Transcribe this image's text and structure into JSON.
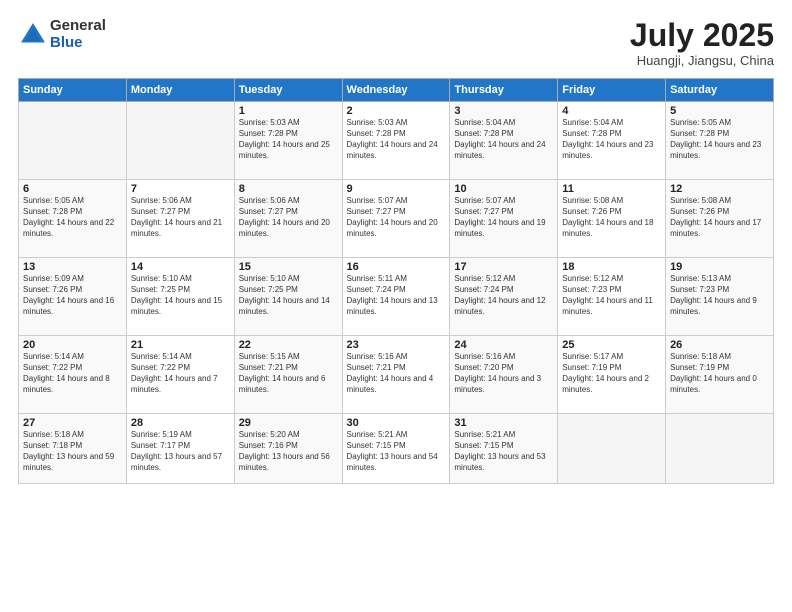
{
  "header": {
    "logo_general": "General",
    "logo_blue": "Blue",
    "month_title": "July 2025",
    "location": "Huangji, Jiangsu, China"
  },
  "weekdays": [
    "Sunday",
    "Monday",
    "Tuesday",
    "Wednesday",
    "Thursday",
    "Friday",
    "Saturday"
  ],
  "weeks": [
    [
      {
        "day": "",
        "sunrise": "",
        "sunset": "",
        "daylight": ""
      },
      {
        "day": "",
        "sunrise": "",
        "sunset": "",
        "daylight": ""
      },
      {
        "day": "1",
        "sunrise": "Sunrise: 5:03 AM",
        "sunset": "Sunset: 7:28 PM",
        "daylight": "Daylight: 14 hours and 25 minutes."
      },
      {
        "day": "2",
        "sunrise": "Sunrise: 5:03 AM",
        "sunset": "Sunset: 7:28 PM",
        "daylight": "Daylight: 14 hours and 24 minutes."
      },
      {
        "day": "3",
        "sunrise": "Sunrise: 5:04 AM",
        "sunset": "Sunset: 7:28 PM",
        "daylight": "Daylight: 14 hours and 24 minutes."
      },
      {
        "day": "4",
        "sunrise": "Sunrise: 5:04 AM",
        "sunset": "Sunset: 7:28 PM",
        "daylight": "Daylight: 14 hours and 23 minutes."
      },
      {
        "day": "5",
        "sunrise": "Sunrise: 5:05 AM",
        "sunset": "Sunset: 7:28 PM",
        "daylight": "Daylight: 14 hours and 23 minutes."
      }
    ],
    [
      {
        "day": "6",
        "sunrise": "Sunrise: 5:05 AM",
        "sunset": "Sunset: 7:28 PM",
        "daylight": "Daylight: 14 hours and 22 minutes."
      },
      {
        "day": "7",
        "sunrise": "Sunrise: 5:06 AM",
        "sunset": "Sunset: 7:27 PM",
        "daylight": "Daylight: 14 hours and 21 minutes."
      },
      {
        "day": "8",
        "sunrise": "Sunrise: 5:06 AM",
        "sunset": "Sunset: 7:27 PM",
        "daylight": "Daylight: 14 hours and 20 minutes."
      },
      {
        "day": "9",
        "sunrise": "Sunrise: 5:07 AM",
        "sunset": "Sunset: 7:27 PM",
        "daylight": "Daylight: 14 hours and 20 minutes."
      },
      {
        "day": "10",
        "sunrise": "Sunrise: 5:07 AM",
        "sunset": "Sunset: 7:27 PM",
        "daylight": "Daylight: 14 hours and 19 minutes."
      },
      {
        "day": "11",
        "sunrise": "Sunrise: 5:08 AM",
        "sunset": "Sunset: 7:26 PM",
        "daylight": "Daylight: 14 hours and 18 minutes."
      },
      {
        "day": "12",
        "sunrise": "Sunrise: 5:08 AM",
        "sunset": "Sunset: 7:26 PM",
        "daylight": "Daylight: 14 hours and 17 minutes."
      }
    ],
    [
      {
        "day": "13",
        "sunrise": "Sunrise: 5:09 AM",
        "sunset": "Sunset: 7:26 PM",
        "daylight": "Daylight: 14 hours and 16 minutes."
      },
      {
        "day": "14",
        "sunrise": "Sunrise: 5:10 AM",
        "sunset": "Sunset: 7:25 PM",
        "daylight": "Daylight: 14 hours and 15 minutes."
      },
      {
        "day": "15",
        "sunrise": "Sunrise: 5:10 AM",
        "sunset": "Sunset: 7:25 PM",
        "daylight": "Daylight: 14 hours and 14 minutes."
      },
      {
        "day": "16",
        "sunrise": "Sunrise: 5:11 AM",
        "sunset": "Sunset: 7:24 PM",
        "daylight": "Daylight: 14 hours and 13 minutes."
      },
      {
        "day": "17",
        "sunrise": "Sunrise: 5:12 AM",
        "sunset": "Sunset: 7:24 PM",
        "daylight": "Daylight: 14 hours and 12 minutes."
      },
      {
        "day": "18",
        "sunrise": "Sunrise: 5:12 AM",
        "sunset": "Sunset: 7:23 PM",
        "daylight": "Daylight: 14 hours and 11 minutes."
      },
      {
        "day": "19",
        "sunrise": "Sunrise: 5:13 AM",
        "sunset": "Sunset: 7:23 PM",
        "daylight": "Daylight: 14 hours and 9 minutes."
      }
    ],
    [
      {
        "day": "20",
        "sunrise": "Sunrise: 5:14 AM",
        "sunset": "Sunset: 7:22 PM",
        "daylight": "Daylight: 14 hours and 8 minutes."
      },
      {
        "day": "21",
        "sunrise": "Sunrise: 5:14 AM",
        "sunset": "Sunset: 7:22 PM",
        "daylight": "Daylight: 14 hours and 7 minutes."
      },
      {
        "day": "22",
        "sunrise": "Sunrise: 5:15 AM",
        "sunset": "Sunset: 7:21 PM",
        "daylight": "Daylight: 14 hours and 6 minutes."
      },
      {
        "day": "23",
        "sunrise": "Sunrise: 5:16 AM",
        "sunset": "Sunset: 7:21 PM",
        "daylight": "Daylight: 14 hours and 4 minutes."
      },
      {
        "day": "24",
        "sunrise": "Sunrise: 5:16 AM",
        "sunset": "Sunset: 7:20 PM",
        "daylight": "Daylight: 14 hours and 3 minutes."
      },
      {
        "day": "25",
        "sunrise": "Sunrise: 5:17 AM",
        "sunset": "Sunset: 7:19 PM",
        "daylight": "Daylight: 14 hours and 2 minutes."
      },
      {
        "day": "26",
        "sunrise": "Sunrise: 5:18 AM",
        "sunset": "Sunset: 7:19 PM",
        "daylight": "Daylight: 14 hours and 0 minutes."
      }
    ],
    [
      {
        "day": "27",
        "sunrise": "Sunrise: 5:18 AM",
        "sunset": "Sunset: 7:18 PM",
        "daylight": "Daylight: 13 hours and 59 minutes."
      },
      {
        "day": "28",
        "sunrise": "Sunrise: 5:19 AM",
        "sunset": "Sunset: 7:17 PM",
        "daylight": "Daylight: 13 hours and 57 minutes."
      },
      {
        "day": "29",
        "sunrise": "Sunrise: 5:20 AM",
        "sunset": "Sunset: 7:16 PM",
        "daylight": "Daylight: 13 hours and 56 minutes."
      },
      {
        "day": "30",
        "sunrise": "Sunrise: 5:21 AM",
        "sunset": "Sunset: 7:15 PM",
        "daylight": "Daylight: 13 hours and 54 minutes."
      },
      {
        "day": "31",
        "sunrise": "Sunrise: 5:21 AM",
        "sunset": "Sunset: 7:15 PM",
        "daylight": "Daylight: 13 hours and 53 minutes."
      },
      {
        "day": "",
        "sunrise": "",
        "sunset": "",
        "daylight": ""
      },
      {
        "day": "",
        "sunrise": "",
        "sunset": "",
        "daylight": ""
      }
    ]
  ]
}
